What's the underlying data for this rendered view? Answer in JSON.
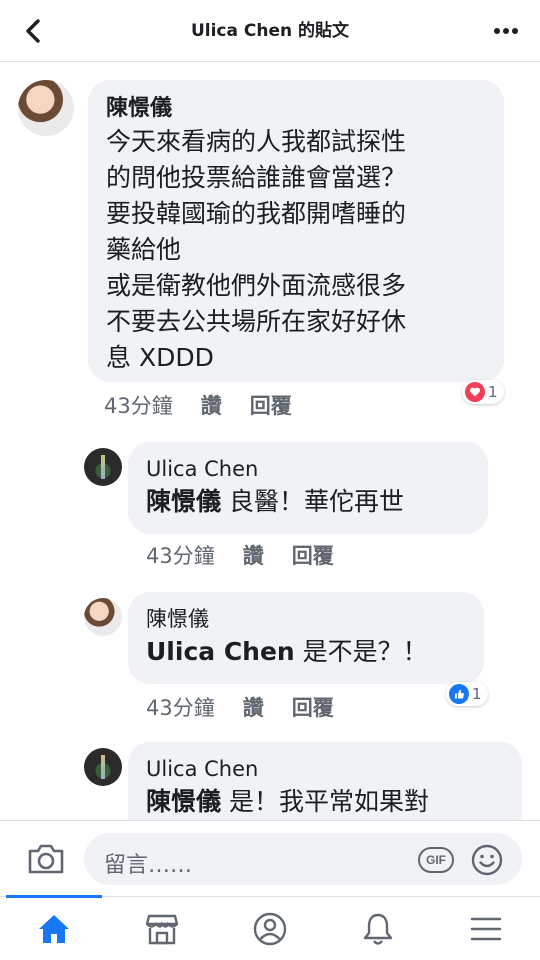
{
  "header": {
    "title": "Ulica Chen 的貼文"
  },
  "comments": [
    {
      "author": "陳憬儀",
      "text": "今天來看病的人我都試探性\n的問他投票給誰誰會當選？\n要投韓國瑜的我都開嗜睡的\n藥給他\n或是衛教他們外面流感很多\n不要去公共場所在家好好休\n息 XDDD",
      "time": "43分鐘",
      "like_label": "讚",
      "reply_label": "回覆",
      "reaction": {
        "type": "love",
        "count": "1",
        "color": "#f33e58"
      }
    },
    {
      "author": "Ulica Chen",
      "mention": "陳憬儀",
      "text": " 良醫！華佗再世",
      "time": "43分鐘",
      "like_label": "讚",
      "reply_label": "回覆"
    },
    {
      "author": "陳憬儀",
      "mention": "Ulica Chen",
      "text": " 是不是？！",
      "time": "43分鐘",
      "like_label": "讚",
      "reply_label": "回覆",
      "reaction": {
        "type": "like",
        "count": "1",
        "color": "#1877f2"
      }
    },
    {
      "author": "Ulica Chen",
      "mention": "陳憬儀",
      "text": " 是！我平常如果對"
    }
  ],
  "composer": {
    "placeholder": "留言……",
    "gif_label": "GIF"
  },
  "nav": {
    "items": [
      "home-icon",
      "marketplace-icon",
      "profile-icon",
      "notifications-icon",
      "menu-icon"
    ],
    "active": "home-icon",
    "accent": "#1877f2",
    "inactive_color": "#606770"
  }
}
